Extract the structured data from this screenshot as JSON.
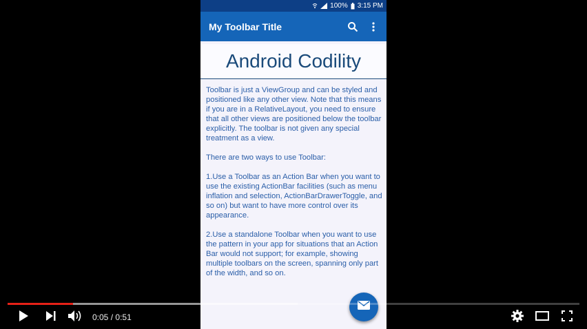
{
  "statusbar": {
    "battery": "100%",
    "time": "3:15 PM"
  },
  "toolbar": {
    "title": "My Toolbar Title",
    "search_icon": "search-icon",
    "menu_icon": "more-vert-icon"
  },
  "app": {
    "heading": "Android Codility",
    "paragraphs": [
      "Toolbar is just a ViewGroup and can be styled and positioned like any other view. Note that this means if you are in a RelativeLayout, you need to ensure that all other views are positioned below the toolbar explicitly. The toolbar is not given any special treatment as a view.",
      "There are two ways to use Toolbar:",
      "1.Use a Toolbar as an Action Bar when you want to use the existing ActionBar facilities (such as menu inflation and selection, ActionBarDrawerToggle, and so on) but want to have more control over its appearance.",
      "2.Use a standalone Toolbar when you want to use the pattern in your app for situations that an Action Bar would not support; for example, showing multiple toolbars on the screen, spanning only part of the width, and so on."
    ],
    "fab_icon": "email-icon"
  },
  "player": {
    "current_time": "0:05",
    "separator": "/",
    "duration": "0:51",
    "played_fraction": 0.115,
    "buffered_fraction": 0.507,
    "colors": {
      "progress": "#e62117",
      "toolbar": "#1565b8"
    }
  }
}
